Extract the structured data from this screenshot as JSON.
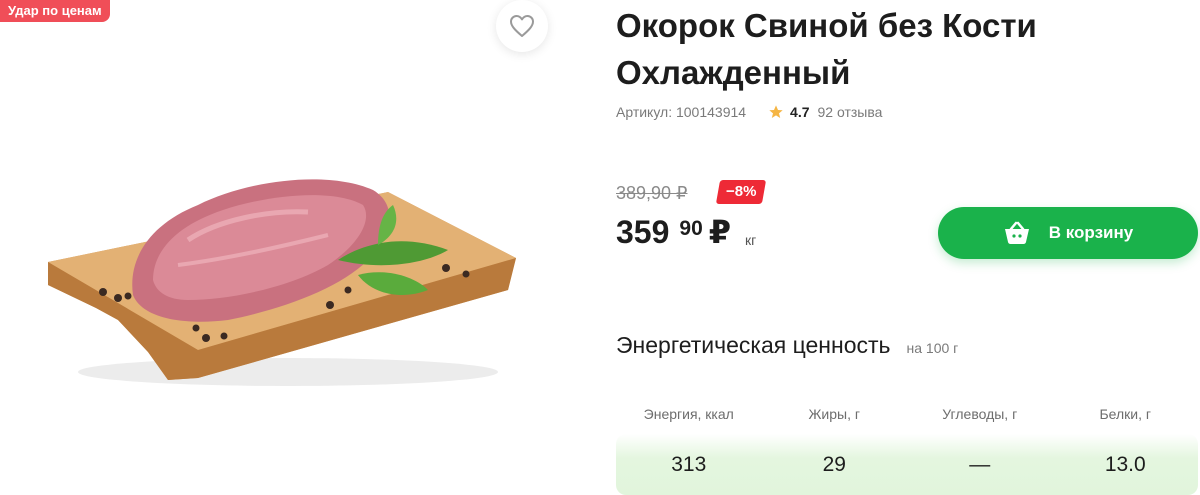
{
  "badge": "Удар по ценам",
  "product": {
    "title": "Окорок Свиной без Кости Охлажденный",
    "sku_label": "Артикул: 100143914",
    "rating": "4.7",
    "reviews": "92 отзыва"
  },
  "price": {
    "old": "389,90 ₽",
    "discount": "−8%",
    "rubles": "359",
    "kopecks": "90",
    "currency": "₽",
    "unit": "кг"
  },
  "cart_button": {
    "label": "В корзину"
  },
  "energy": {
    "title": "Энергетическая ценность",
    "per": "на 100 г",
    "headers": [
      "Энергия, ккал",
      "Жиры, г",
      "Углеводы, г",
      "Белки, г"
    ],
    "values": [
      "313",
      "29",
      "—",
      "13.0"
    ]
  },
  "colors": {
    "accent_green": "#1ab24b",
    "discount_red": "#ee2a36",
    "badge_red": "#f04e58",
    "star": "#f5b544"
  },
  "icons": [
    "heart-icon",
    "star-icon",
    "basket-icon"
  ]
}
